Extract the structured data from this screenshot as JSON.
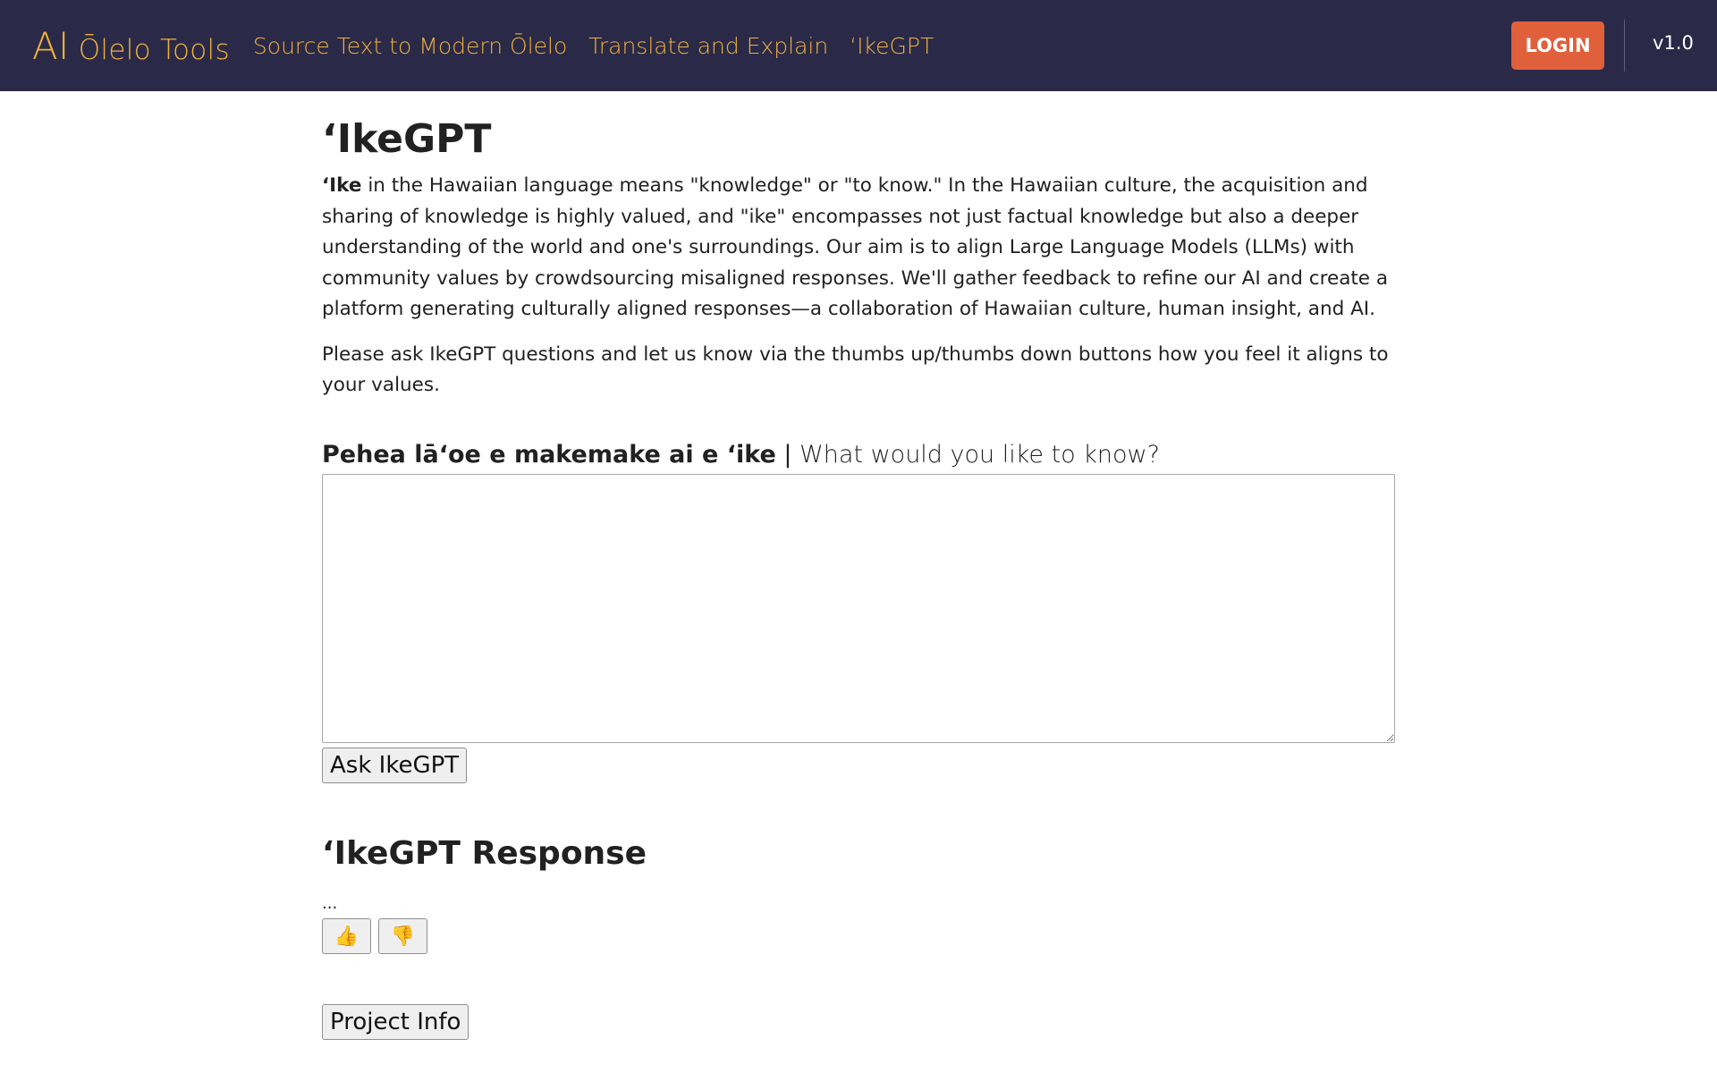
{
  "nav": {
    "brand_ai": "AI",
    "brand_rest": "Ōlelo Tools",
    "links": [
      "Source Text to Modern Ōlelo",
      "Translate and Explain",
      "ʻIkeGPT"
    ],
    "login_label": "LOGIN",
    "version": "v1.0"
  },
  "colors": {
    "navbar_bg": "#2a2a48",
    "accent": "#f0b03d",
    "login_bg": "#e0603c"
  },
  "main": {
    "title": "ʻIkeGPT",
    "intro_bold": "ʻIke",
    "intro_rest": " in the Hawaiian language means \"knowledge\" or \"to know.\" In the Hawaiian culture, the acquisition and sharing of knowledge is highly valued, and \"ike\" encompasses not just factual knowledge but also a deeper understanding of the world and one's surroundings. Our aim is to align Large Language Models (LLMs) with community values by crowdsourcing misaligned responses. We'll gather feedback to refine our AI and create a platform generating culturally aligned responses—a collaboration of Hawaiian culture, human insight, and AI.",
    "ask_note": "Please ask IkeGPT questions and let us know via the thumbs up/thumbs down buttons how you feel it aligns to your values.",
    "question_label_hw": "Pehea lāʻoe e makemake ai e ʻike",
    "question_label_sep": " | ",
    "question_label_en": "What would you like to know?",
    "question_value": "",
    "ask_button": "Ask IkeGPT",
    "response_title": "ʻIkeGPT Response",
    "response_text": "...",
    "thumbs_up": "👍",
    "thumbs_down": "👎",
    "project_info_button": "Project Info"
  }
}
